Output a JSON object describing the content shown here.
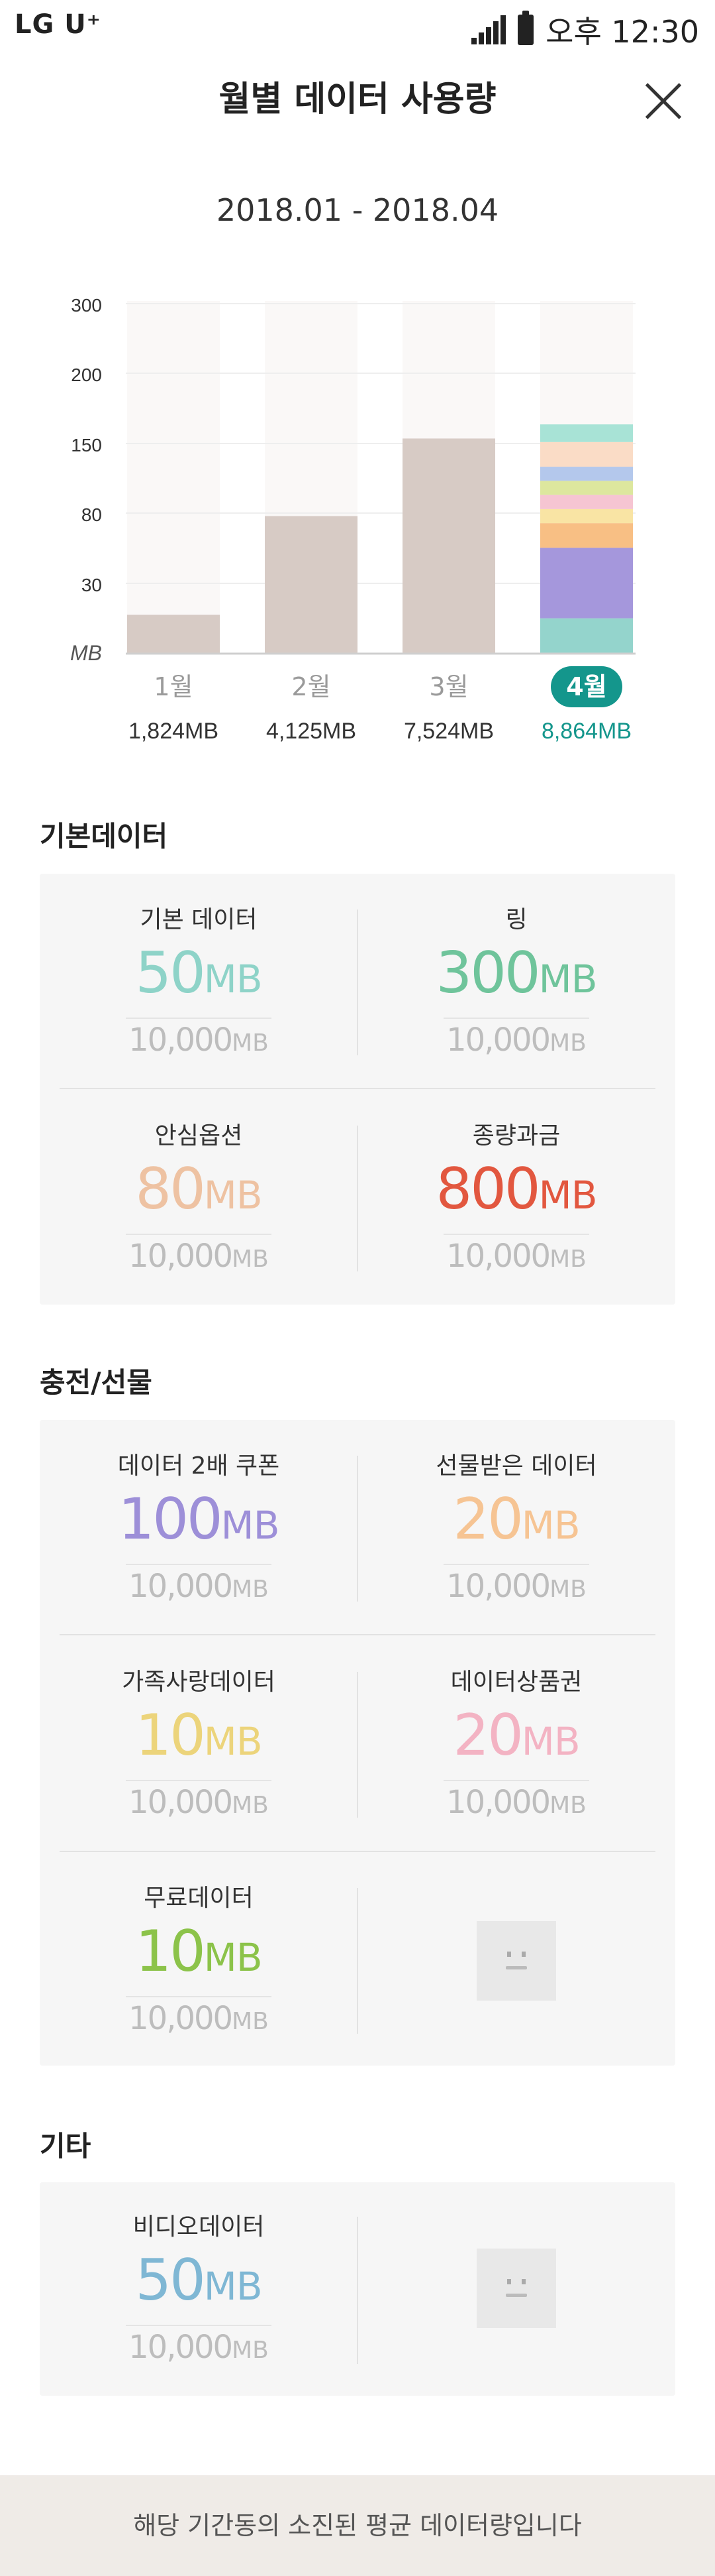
{
  "status_bar": {
    "carrier": "LG U⁺",
    "time": "오후 12:30"
  },
  "header": {
    "title": "월별 데이터 사용량"
  },
  "date_range": "2018.01 - 2018.04",
  "chart_data": {
    "type": "bar",
    "y_unit": "MB",
    "y_ticks": [
      "300",
      "200",
      "150",
      "80",
      "30"
    ],
    "categories": [
      "1월",
      "2월",
      "3월",
      "4월"
    ],
    "totals": [
      "1,824MB",
      "4,125MB",
      "7,524MB",
      "8,864MB"
    ],
    "selected_index": 3,
    "bar_fraction": [
      0.11,
      0.39,
      0.61,
      0.65
    ],
    "stacked_segments": [
      {
        "color": "#94d4cc",
        "fraction": 0.1
      },
      {
        "color": "#a597dc",
        "fraction": 0.2
      },
      {
        "color": "#f8bf84",
        "fraction": 0.07
      },
      {
        "color": "#f9e4a4",
        "fraction": 0.04
      },
      {
        "color": "#f6c5d2",
        "fraction": 0.04
      },
      {
        "color": "#dde79e",
        "fraction": 0.04
      },
      {
        "color": "#b4c8ec",
        "fraction": 0.04
      },
      {
        "color": "#fadcc6",
        "fraction": 0.07
      },
      {
        "color": "#a8e3d6",
        "fraction": 0.05
      }
    ],
    "colors": {
      "bar": "#d7cbc5",
      "selected": "#14968c",
      "column_bg": "#faf8f7"
    }
  },
  "sections": {
    "basic": {
      "title": "기본데이터",
      "items": [
        {
          "label": "기본 데이터",
          "value": "50",
          "unit": "MB",
          "total": "10,000",
          "total_unit": "MB",
          "color": "#8ed3c8"
        },
        {
          "label": "링",
          "value": "300",
          "unit": "MB",
          "total": "10,000",
          "total_unit": "MB",
          "color": "#6fc49b"
        },
        {
          "label": "안심옵션",
          "value": "80",
          "unit": "MB",
          "total": "10,000",
          "total_unit": "MB",
          "color": "#eec2a2"
        },
        {
          "label": "종량과금",
          "value": "800",
          "unit": "MB",
          "total": "10,000",
          "total_unit": "MB",
          "color": "#e2573f"
        }
      ]
    },
    "charge": {
      "title": "충전/선물",
      "items": [
        {
          "label": "데이터 2배 쿠폰",
          "value": "100",
          "unit": "MB",
          "total": "10,000",
          "total_unit": "MB",
          "color": "#9d8fd8"
        },
        {
          "label": "선물받은 데이터",
          "value": "20",
          "unit": "MB",
          "total": "10,000",
          "total_unit": "MB",
          "color": "#f6c493"
        },
        {
          "label": "가족사랑데이터",
          "value": "10",
          "unit": "MB",
          "total": "10,000",
          "total_unit": "MB",
          "color": "#ecd47b"
        },
        {
          "label": "데이터상품권",
          "value": "20",
          "unit": "MB",
          "total": "10,000",
          "total_unit": "MB",
          "color": "#f3b3c3"
        },
        {
          "label": "무료데이터",
          "value": "10",
          "unit": "MB",
          "total": "10,000",
          "total_unit": "MB",
          "color": "#8cc34a"
        }
      ]
    },
    "etc": {
      "title": "기타",
      "items": [
        {
          "label": "비디오데이터",
          "value": "50",
          "unit": "MB",
          "total": "10,000",
          "total_unit": "MB",
          "color": "#7fb7d4"
        }
      ]
    }
  },
  "footer": {
    "text": "해당 기간동의 소진된 평균 데이터량입니다"
  }
}
